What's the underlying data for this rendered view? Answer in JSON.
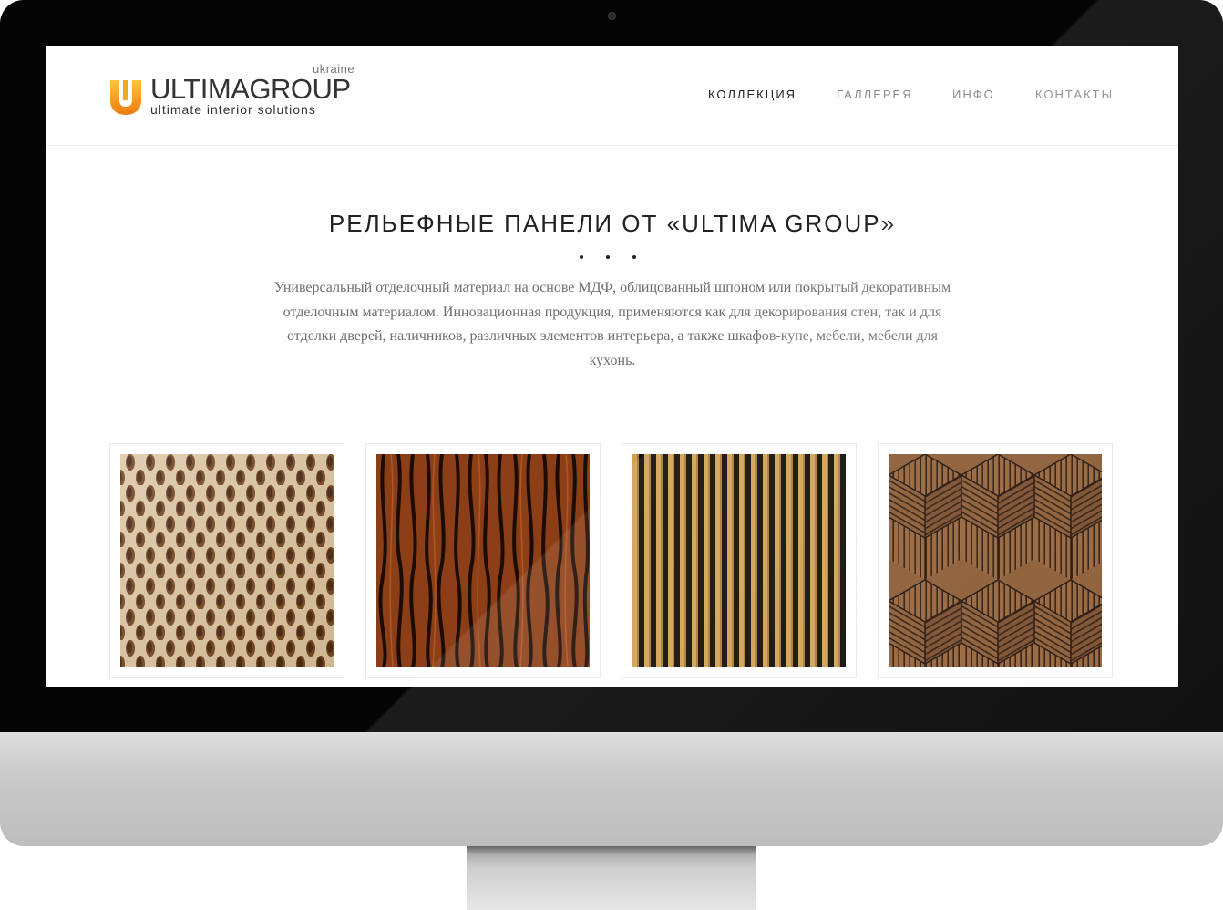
{
  "logo": {
    "region": "ukraine",
    "name": "ULTIMAGROUP",
    "tagline": "ultimate interior solutions",
    "accent_color": "#f29a16"
  },
  "nav": {
    "items": [
      {
        "label": "КОЛЛЕКЦИЯ",
        "active": true
      },
      {
        "label": "ГАЛЛЕРЕЯ",
        "active": false
      },
      {
        "label": "ИНФО",
        "active": false
      },
      {
        "label": "КОНТАКТЫ",
        "active": false
      }
    ]
  },
  "intro": {
    "title": "РЕЛЬЕФНЫЕ ПАНЕЛИ ОТ «ULTIMA GROUP»",
    "text": "Универсальный отделочный материал на основе МДФ, облицованный шпоном или покрытый декоративным отделочным материалом. Инновационная продукция, применяются как для декорирования стен, так и для отделки дверей, наличников, различных элементов интерьера, а также шкафов-купе, мебели, мебели для кухонь."
  },
  "products": [
    {
      "pattern": "perforated-ovals-light-wood"
    },
    {
      "pattern": "wavy-grooves-dark-wood"
    },
    {
      "pattern": "vertical-slats-oak"
    },
    {
      "pattern": "hexagonal-cube-walnut"
    }
  ]
}
